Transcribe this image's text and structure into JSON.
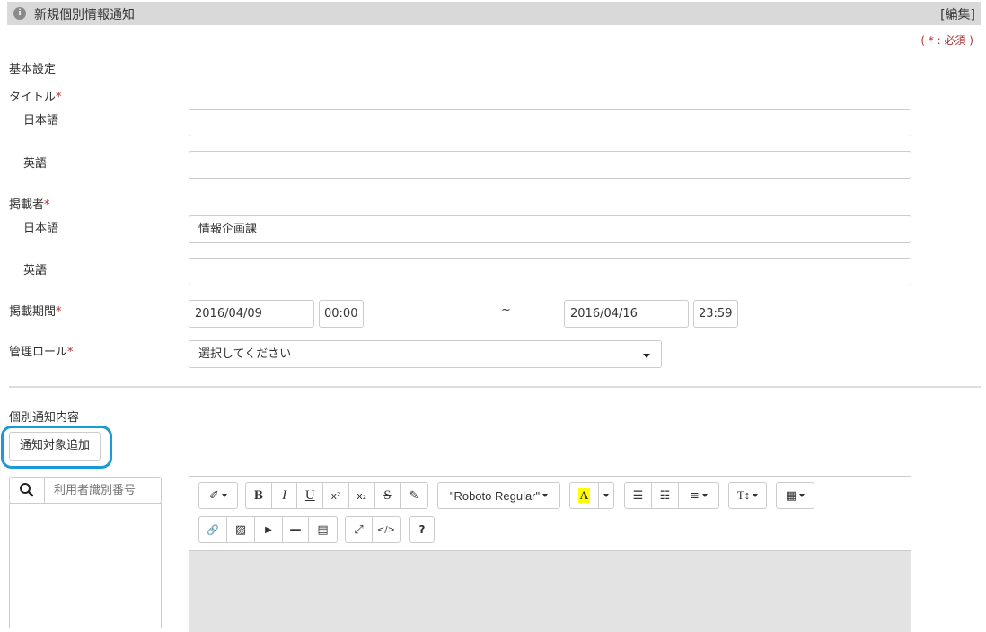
{
  "panel": {
    "title": "新規個別情報通知",
    "edit_link": "[編集]",
    "info_icon": "i"
  },
  "required_note": "( * : 必須 )",
  "section_basic": "基本設定",
  "title_field": {
    "label": "タイトル",
    "required_mark": "*",
    "ja_label": "日本語",
    "ja_value": "",
    "en_label": "英語",
    "en_value": ""
  },
  "publisher_field": {
    "label": "掲載者",
    "required_mark": "*",
    "ja_label": "日本語",
    "ja_value": "情報企画課",
    "en_label": "英語",
    "en_value": ""
  },
  "period_field": {
    "label": "掲載期間",
    "required_mark": "*",
    "start_date": "2016/04/09",
    "start_time": "00:00",
    "separator": "~",
    "end_date": "2016/04/16",
    "end_time": "23:59"
  },
  "role_field": {
    "label": "管理ロール",
    "required_mark": "*",
    "selected": "選択してください"
  },
  "section_individual": "個別通知内容",
  "add_target_button": "通知対象追加",
  "user_search": {
    "placeholder": "利用者識別番号",
    "icon": "search-icon"
  },
  "editor_toolbar": {
    "magic": "✐",
    "bold": "B",
    "italic": "I",
    "underline": "U",
    "superscript": "x²",
    "subscript": "x₂",
    "strikethrough": "S",
    "eraser": "✎",
    "font_name": "\"Roboto Regular\"",
    "font_color": "A",
    "font_color_highlight": "#ffff00",
    "unordered_list": "☰",
    "ordered_list": "☷",
    "align": "≡",
    "font_size": "T↕",
    "table": "▦",
    "link": "🔗",
    "image": "▨",
    "video": "▶",
    "hr": "—",
    "calculator": "▤",
    "fullscreen": "⤢",
    "code": "</>",
    "help": "?"
  },
  "colors": {
    "accent_highlight": "#1a9ad6",
    "required": "#b03030"
  }
}
